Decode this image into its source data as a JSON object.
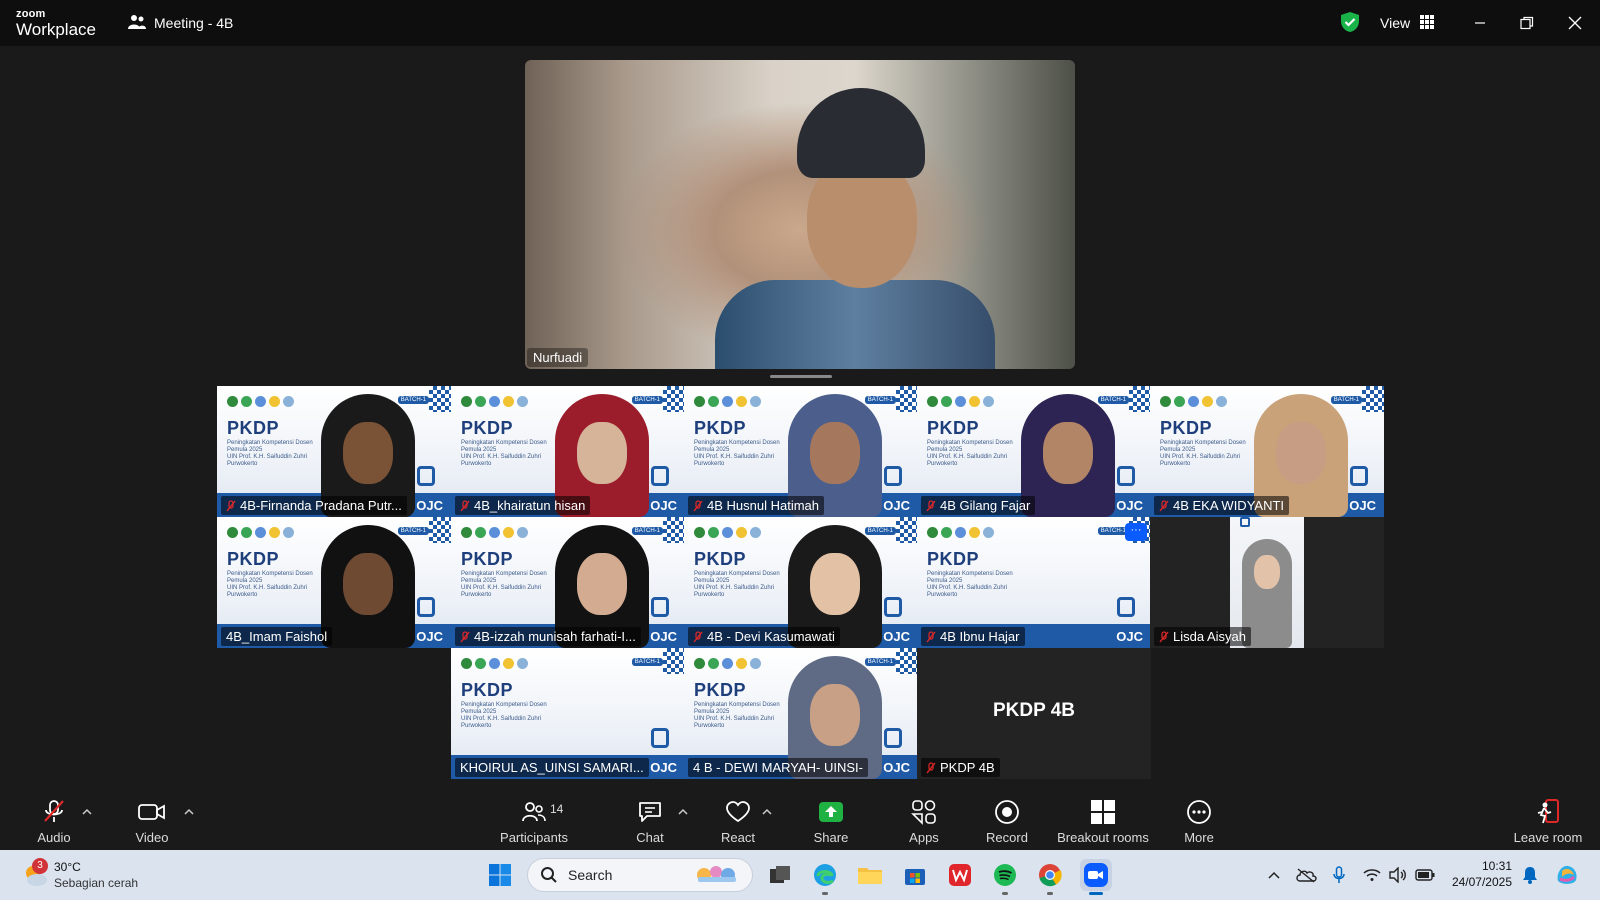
{
  "app": {
    "brand_small": "zoom",
    "brand_large": "Workplace",
    "meeting_title": "Meeting - 4B",
    "view_label": "View"
  },
  "main_speaker": {
    "name": "Nurfuadi"
  },
  "tiles": [
    {
      "name": "4B-Firnanda Pradana Putr...",
      "muted": true,
      "slide": true
    },
    {
      "name": "4B_khairatun hisan",
      "muted": true,
      "slide": true
    },
    {
      "name": "4B Husnul Hatimah",
      "muted": true,
      "slide": true
    },
    {
      "name": "4B Gilang Fajar",
      "muted": true,
      "slide": true
    },
    {
      "name": "4B EKA WIDYANTI",
      "muted": true,
      "slide": true
    },
    {
      "name": "4B_Imam Faishol",
      "muted": false,
      "slide": true
    },
    {
      "name": "4B-izzah munisah farhati-I...",
      "muted": true,
      "slide": true
    },
    {
      "name": "4B - Devi Kasumawati",
      "muted": true,
      "slide": true
    },
    {
      "name": "4B Ibnu Hajar",
      "muted": true,
      "slide": true
    },
    {
      "name": "Lisda Aisyah",
      "muted": true,
      "slide": false
    },
    {
      "name": "KHOIRUL AS_UINSI SAMARI...",
      "muted": false,
      "slide": true
    },
    {
      "name": "4 B - DEWI MARYAH- UINSI-",
      "muted": false,
      "slide": true
    },
    {
      "name": "PKDP 4B",
      "muted": true,
      "slide": false,
      "label": "PKDP 4B"
    }
  ],
  "slide": {
    "heading": "PKDP",
    "subtext": "Peningkatan Kompetensi Dosen Pemula 2025",
    "university": "UIN Prof. K.H. Saifuddin Zuhri Purwokerto",
    "batch": "BATCH-1",
    "ojc": "OJC"
  },
  "toolbar": {
    "audio": "Audio",
    "video": "Video",
    "participants": "Participants",
    "participants_count": "14",
    "chat": "Chat",
    "react": "React",
    "share": "Share",
    "apps": "Apps",
    "record": "Record",
    "breakout": "Breakout rooms",
    "more": "More",
    "leave": "Leave room"
  },
  "taskbar": {
    "weather_badge": "3",
    "temperature": "30°C",
    "condition": "Sebagian cerah",
    "search_placeholder": "Search",
    "time": "10:31",
    "date": "24/07/2025"
  },
  "colors": {
    "accent": "#0b5cff",
    "share_green": "#1fb141",
    "leave_red": "#e02828",
    "slide_blue": "#1f5aa6"
  }
}
